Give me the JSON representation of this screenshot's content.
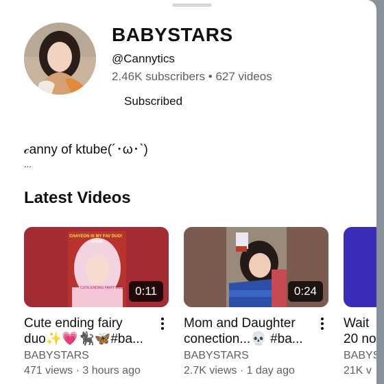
{
  "channel": {
    "name": "BABYSTARS",
    "handle": "@Cannytics",
    "stats": "2.46K subscribers • 627 videos",
    "subscribe_label": "Subscribed",
    "description": "𝒸anny of ktube(´･ω･`)",
    "description_more": "..."
  },
  "section": {
    "title": "Latest Videos"
  },
  "videos": [
    {
      "title_line1": "Cute ending fairy",
      "title_line2": "duo✨💗🐈‍⬛🦋#ba...",
      "duration": "0:11",
      "channel": "BABYSTARS",
      "meta": "471 views · 3 hours ago",
      "thumb_banner": "CHAYEON IS MY FAV DUO!",
      "thumb_name": "AYEON",
      "thumb_caption": "CUTE ENDING FAIRY DUO"
    },
    {
      "title_line1": "Mom and Daughter",
      "title_line2": "conection...💀 #ba...",
      "duration": "0:24",
      "channel": "BABYSTARS",
      "meta": "2.7K views · 1 day ago"
    },
    {
      "title_line1": "Wait",
      "title_line2": "20 no",
      "channel": "BABYS",
      "meta": "21K v"
    }
  ],
  "colors": {
    "background_scrim": "#8a9299",
    "sheet": "#ffffff",
    "thumb1": "#a32b33",
    "thumb2": "#7b5a4f",
    "thumb3": "#3a2bb8",
    "secondary_text": "#606060"
  },
  "icons": [
    "avatar",
    "more-vert-icon",
    "drag-handle"
  ]
}
